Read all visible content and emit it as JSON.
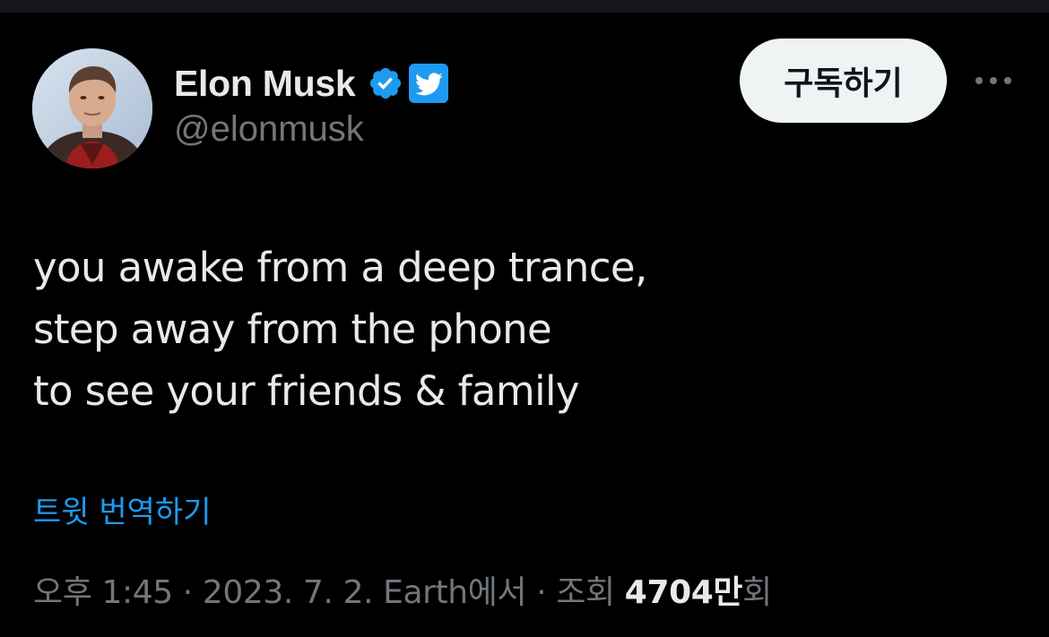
{
  "author": {
    "display_name": "Elon Musk",
    "handle": "@elonmusk",
    "avatar_alt": "Elon Musk avatar",
    "verified_icon": "verified-badge-icon",
    "badge_icon": "twitter-bird-icon"
  },
  "actions": {
    "subscribe_label": "구독하기",
    "more_icon": "more-icon"
  },
  "tweet": {
    "lines": [
      "you awake from a deep trance,",
      "step away from the phone",
      "to see your friends & family"
    ],
    "translate_label": "트윗 번역하기"
  },
  "meta": {
    "time": "오후 1:45",
    "separator": " · ",
    "date": "2023. 7. 2.",
    "location": "Earth에서",
    "views_label": "조회",
    "views_count": "4704만",
    "views_suffix": "회"
  },
  "colors": {
    "background": "#000000",
    "text_primary": "#e7e9ea",
    "text_secondary": "#71767b",
    "accent": "#1d9bf0",
    "button_bg": "#eff3f4"
  }
}
